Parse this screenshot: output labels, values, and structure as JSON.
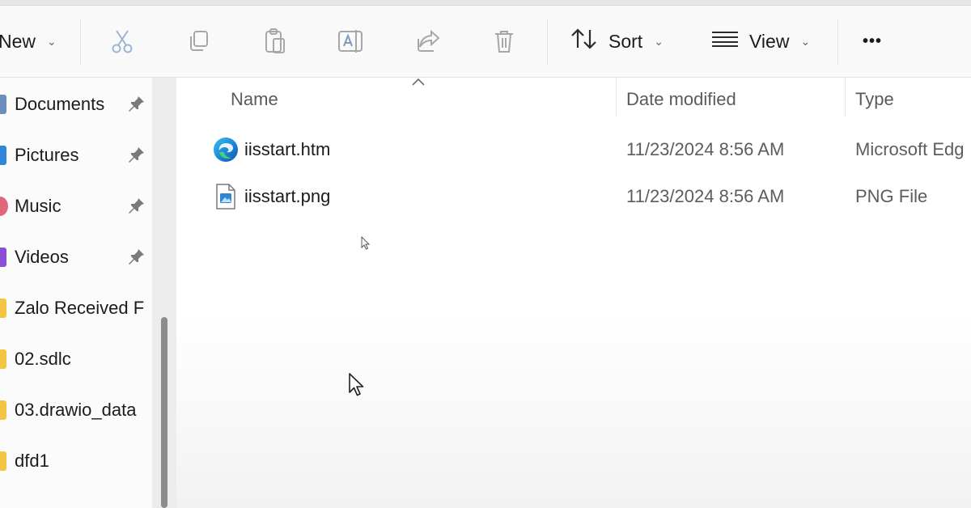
{
  "toolbar": {
    "new_label": "New",
    "sort_label": "Sort",
    "view_label": "View",
    "more_glyph": "•••",
    "icons": [
      "cut-icon",
      "copy-icon",
      "paste-icon",
      "rename-icon",
      "share-icon",
      "delete-icon"
    ]
  },
  "sidebar": {
    "items": [
      {
        "label": "Documents",
        "icon": "documents-icon",
        "pinned": true
      },
      {
        "label": "Pictures",
        "icon": "pictures-icon",
        "pinned": true
      },
      {
        "label": "Music",
        "icon": "music-icon",
        "pinned": true
      },
      {
        "label": "Videos",
        "icon": "videos-icon",
        "pinned": true
      },
      {
        "label": "Zalo Received F",
        "icon": "folder-icon",
        "pinned": false
      },
      {
        "label": "02.sdlc",
        "icon": "folder-icon",
        "pinned": false
      },
      {
        "label": "03.drawio_data",
        "icon": "folder-icon",
        "pinned": false
      },
      {
        "label": "dfd1",
        "icon": "folder-icon",
        "pinned": false
      }
    ]
  },
  "columns": {
    "name": "Name",
    "date_modified": "Date modified",
    "type": "Type"
  },
  "files": [
    {
      "name": "iisstart.htm",
      "date": "11/23/2024 8:56 AM",
      "type": "Microsoft Edg",
      "icon": "edge-icon"
    },
    {
      "name": "iisstart.png",
      "date": "11/23/2024 8:56 AM",
      "type": "PNG File",
      "icon": "png-file-icon"
    }
  ],
  "colors": {
    "accent": "#0067c0",
    "folder": "#f4c542",
    "toolbar_icon_disabled": "#a7a7a7"
  }
}
